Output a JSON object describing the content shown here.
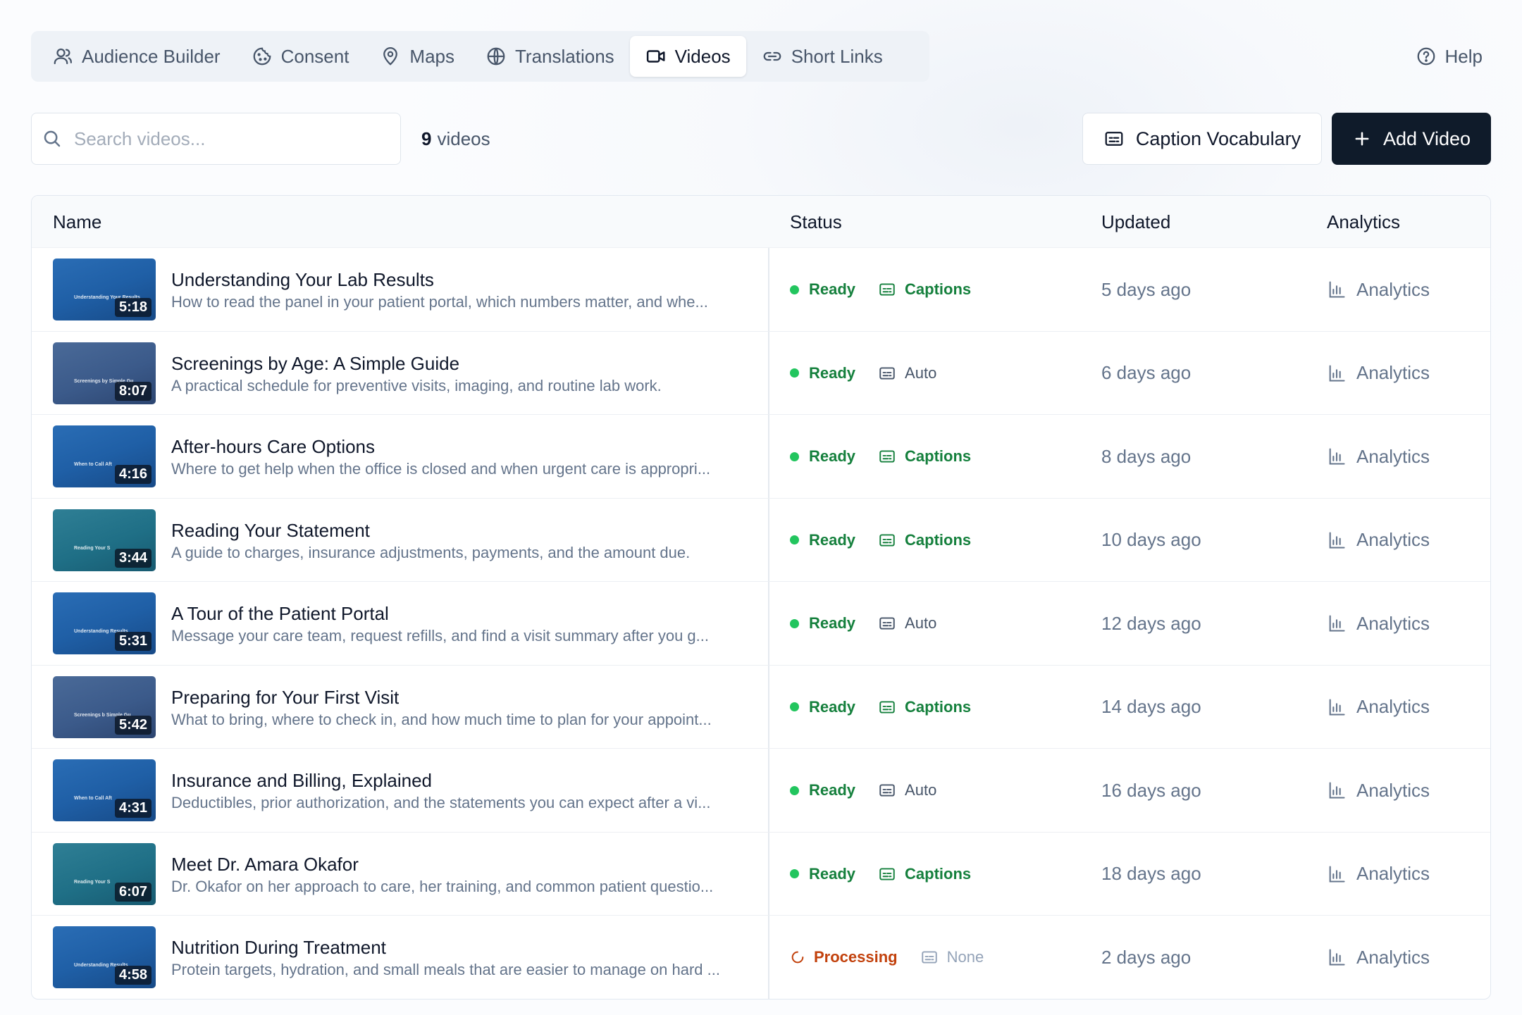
{
  "nav": {
    "tabs": [
      {
        "label": "Audience Builder",
        "icon": "user-icon"
      },
      {
        "label": "Consent",
        "icon": "cookie-icon"
      },
      {
        "label": "Maps",
        "icon": "map-pin-icon"
      },
      {
        "label": "Translations",
        "icon": "globe-icon"
      },
      {
        "label": "Videos",
        "icon": "video-icon",
        "active": true
      },
      {
        "label": "Short Links",
        "icon": "link-icon"
      }
    ],
    "help_label": "Help"
  },
  "toolbar": {
    "search_placeholder": "Search videos...",
    "count_number": "9",
    "count_label": "videos",
    "caption_vocab_label": "Caption Vocabulary",
    "add_video_label": "Add Video"
  },
  "table": {
    "headers": {
      "name": "Name",
      "status": "Status",
      "updated": "Updated",
      "analytics": "Analytics"
    },
    "rows": [
      {
        "title": "Understanding Your Lab Results",
        "desc": "How to read the panel in your patient portal, which numbers matter, and whe...",
        "duration": "5:18",
        "thumb_text": "Understanding Your Results",
        "status": "Ready",
        "captions": "Captions",
        "updated": "5 days ago",
        "analytics": "Analytics"
      },
      {
        "title": "Screenings by Age: A Simple Guide",
        "desc": "A practical schedule for preventive visits, imaging, and routine lab work.",
        "duration": "8:07",
        "thumb_text": "Screenings by Simple Gu",
        "status": "Ready",
        "captions": "Auto",
        "updated": "6 days ago",
        "analytics": "Analytics"
      },
      {
        "title": "After-hours Care Options",
        "desc": "Where to get help when the office is closed and when urgent care is appropri...",
        "duration": "4:16",
        "thumb_text": "When to Call Aft",
        "status": "Ready",
        "captions": "Captions",
        "updated": "8 days ago",
        "analytics": "Analytics"
      },
      {
        "title": "Reading Your Statement",
        "desc": "A guide to charges, insurance adjustments, payments, and the amount due.",
        "duration": "3:44",
        "thumb_text": "Reading Your S",
        "status": "Ready",
        "captions": "Captions",
        "updated": "10 days ago",
        "analytics": "Analytics"
      },
      {
        "title": "A Tour of the Patient Portal",
        "desc": "Message your care team, request refills, and find a visit summary after you g...",
        "duration": "5:31",
        "thumb_text": "Understanding Results",
        "status": "Ready",
        "captions": "Auto",
        "updated": "12 days ago",
        "analytics": "Analytics"
      },
      {
        "title": "Preparing for Your First Visit",
        "desc": "What to bring, where to check in, and how much time to plan for your appoint...",
        "duration": "5:42",
        "thumb_text": "Screenings b Simple Gu",
        "status": "Ready",
        "captions": "Captions",
        "updated": "14 days ago",
        "analytics": "Analytics"
      },
      {
        "title": "Insurance and Billing, Explained",
        "desc": "Deductibles, prior authorization, and the statements you can expect after a vi...",
        "duration": "4:31",
        "thumb_text": "When to Call Aft",
        "status": "Ready",
        "captions": "Auto",
        "updated": "16 days ago",
        "analytics": "Analytics"
      },
      {
        "title": "Meet Dr. Amara Okafor",
        "desc": "Dr. Okafor on her approach to care, her training, and common patient questio...",
        "duration": "6:07",
        "thumb_text": "Reading Your S",
        "status": "Ready",
        "captions": "Captions",
        "updated": "18 days ago",
        "analytics": "Analytics"
      },
      {
        "title": "Nutrition During Treatment",
        "desc": "Protein targets, hydration, and small meals that are easier to manage on hard ...",
        "duration": "4:58",
        "thumb_text": "Understanding Results",
        "status": "Processing",
        "captions": "None",
        "updated": "2 days ago",
        "analytics": "Analytics"
      }
    ]
  },
  "colors": {
    "ready_green": "#15803d",
    "dot_green": "#22c55e",
    "processing_orange": "#c2410c",
    "primary_dark": "#0f1b2a"
  }
}
